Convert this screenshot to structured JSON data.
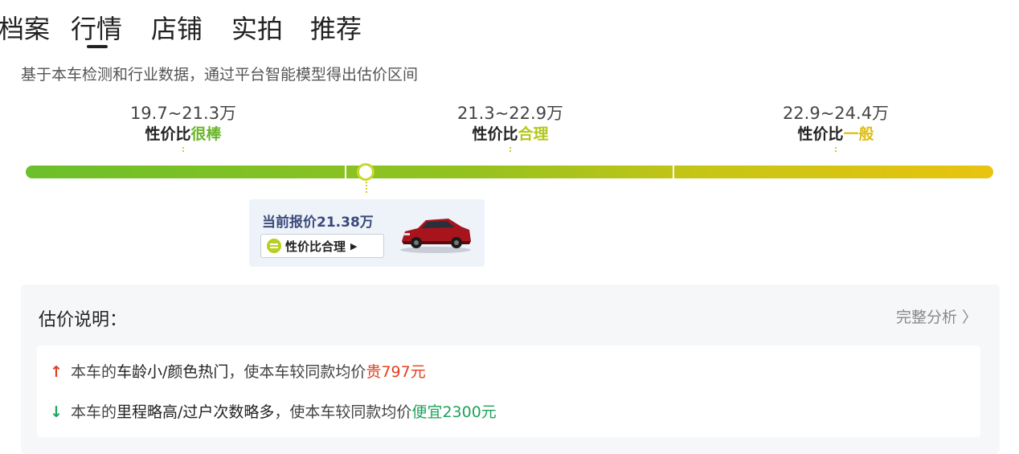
{
  "tabs": [
    "档案",
    "行情",
    "店铺",
    "实拍",
    "推荐"
  ],
  "subtitle": "基于本车检测和行业数据，通过平台智能模型得出估价区间",
  "ranges": [
    {
      "price": "19.7~21.3万",
      "prefix": "性价比",
      "verdict": "很棒",
      "color": "#6ab52a"
    },
    {
      "price": "21.3~22.9万",
      "prefix": "性价比",
      "verdict": "合理",
      "color": "#b3c71f"
    },
    {
      "price": "22.9~24.4万",
      "prefix": "性价比",
      "verdict": "一般",
      "color": "#e0bd10"
    }
  ],
  "current": {
    "price_label": "当前报价21.38万",
    "tag_label": "性价比合理",
    "position_fraction": 0.35
  },
  "panel": {
    "title": "估价说明：",
    "link": "完整分析",
    "rows": [
      {
        "direction": "up",
        "prefix": "本车的",
        "factor": "车龄小/颜色热门",
        "middle": "，使本车较同款均价",
        "result": "贵797元",
        "color": "#e0401f"
      },
      {
        "direction": "down",
        "prefix": "本车的",
        "factor": "里程略高/过户次数略多",
        "middle": "，使本车较同款均价",
        "result": "便宜2300元",
        "color": "#1ea25a"
      }
    ]
  }
}
